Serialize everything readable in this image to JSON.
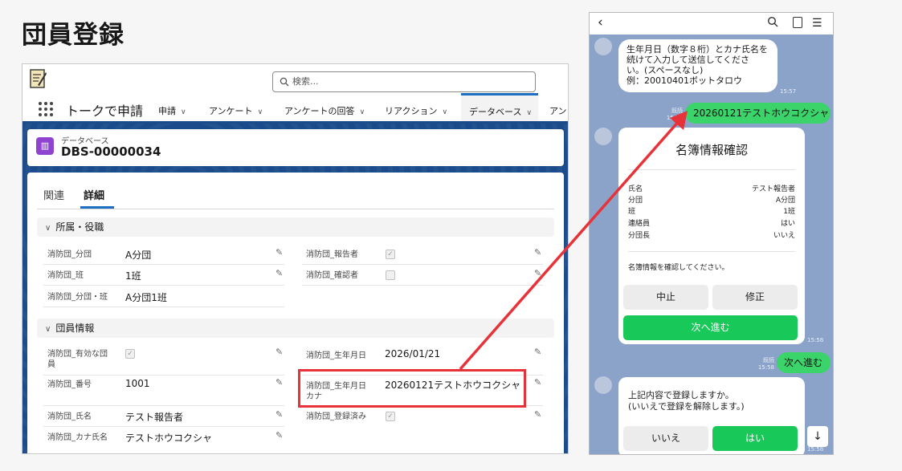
{
  "page_title": "団員登録",
  "salesforce": {
    "search_placeholder": "検索...",
    "app_name": "トークで申請",
    "nav_tabs": [
      "申請",
      "アンケート",
      "アンケートの回答",
      "リアクション",
      "データベース",
      "アン"
    ],
    "record_type": "データベース",
    "record_name": "DBS-00000034",
    "detail_tabs": [
      "関連",
      "詳細"
    ],
    "sections": {
      "affiliation": {
        "title": "所属・役職",
        "fields": [
          {
            "label": "消防団_分団",
            "value": "A分団"
          },
          {
            "label": "消防団_班",
            "value": "1班"
          },
          {
            "label": "消防団_分団・班",
            "value": "A分団1班"
          },
          {
            "label": "消防団_報告者",
            "value": "✓"
          },
          {
            "label": "消防団_確認者",
            "value": ""
          }
        ]
      },
      "member": {
        "title": "団員情報",
        "fields": [
          {
            "label": "消防団_有効な団員",
            "value": "✓"
          },
          {
            "label": "消防団_番号",
            "value": "1001"
          },
          {
            "label": "消防団_氏名",
            "value": "テスト報告者"
          },
          {
            "label": "消防団_カナ氏名",
            "value": "テストホウコクシャ"
          },
          {
            "label": "消防団_生年月日",
            "value": "2026/01/21"
          },
          {
            "label": "消防団_生年月日カナ",
            "value": "20260121テストホウコクシャ"
          },
          {
            "label": "消防団_登録済み",
            "value": "✓"
          }
        ]
      }
    }
  },
  "chat": {
    "msg1": [
      "生年月日（数字８桁）とカナ氏名を",
      "続けて入力して送信してくださ",
      "い。(スペースなし)",
      "例：20010401ボットタロウ"
    ],
    "msg1_time": "15:57",
    "reply1": "20260121テストホウコクシャ",
    "reply1_read": "既読",
    "reply1_time": "15:58",
    "card": {
      "title": "名簿情報確認",
      "rows": [
        {
          "k": "氏名",
          "v": "テスト報告者"
        },
        {
          "k": "分団",
          "v": "A分団"
        },
        {
          "k": "班",
          "v": "1班"
        },
        {
          "k": "連絡員",
          "v": "はい"
        },
        {
          "k": "分団長",
          "v": "いいえ"
        }
      ],
      "message": "名簿情報を確認してください。",
      "cancel": "中止",
      "edit": "修正",
      "next": "次へ進む",
      "time": "15:58"
    },
    "reply2": "次へ進む",
    "reply2_read": "既読",
    "reply2_time": "15:58",
    "confirm": {
      "lines": [
        "上記内容で登録しますか。",
        "(いいえで登録を解除します。)"
      ],
      "no": "いいえ",
      "yes": "はい",
      "time": "15:58"
    }
  },
  "colors": {
    "highlight": "#e8323a",
    "line_green": "#18c858",
    "sf_blue": "#1b4b8a"
  }
}
